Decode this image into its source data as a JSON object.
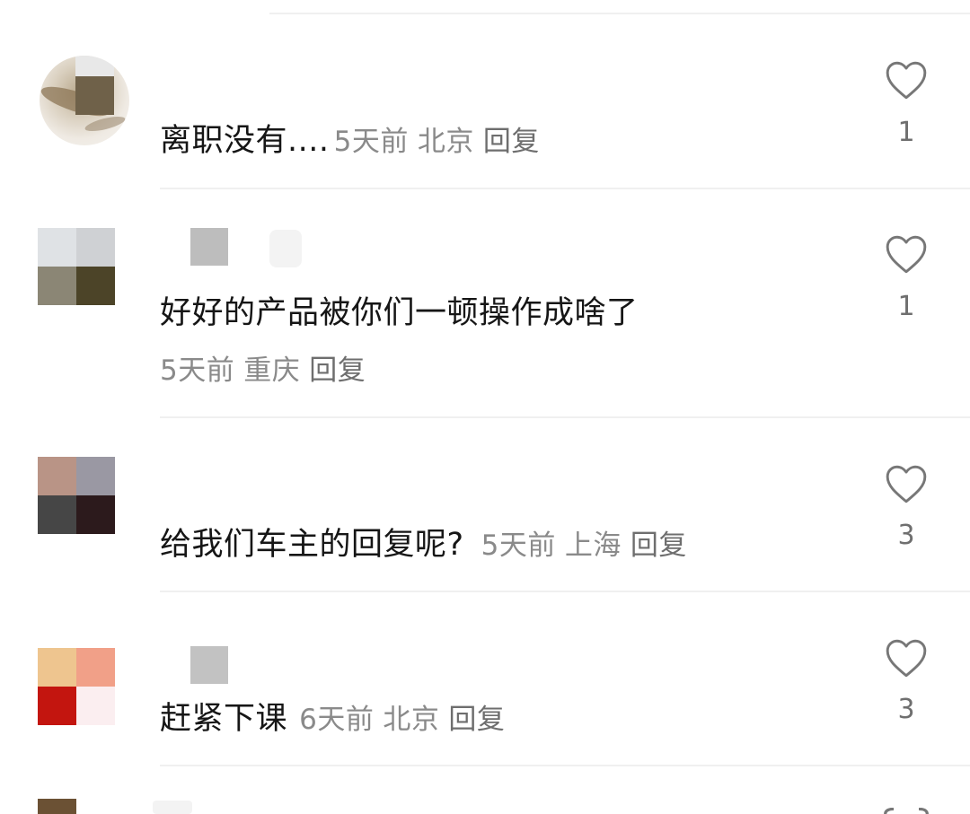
{
  "comments": [
    {
      "text": "离职没有....",
      "time": "5天前",
      "location": "北京",
      "reply": "回复",
      "likes": "1"
    },
    {
      "text": "好好的产品被你们一顿操作成啥了",
      "time": "5天前",
      "location": "重庆",
      "reply": "回复",
      "likes": "1"
    },
    {
      "text": "给我们车主的回复呢?",
      "time": "5天前",
      "location": "上海",
      "reply": "回复",
      "likes": "3"
    },
    {
      "text": "赶紧下课",
      "time": "6天前",
      "location": "北京",
      "reply": "回复",
      "likes": "3"
    }
  ],
  "icons": {
    "like": "heart-outline-icon"
  },
  "colors": {
    "text": "#161616",
    "meta": "#8a8a8a",
    "divider": "#f0f0f0",
    "icon": "#777777"
  }
}
